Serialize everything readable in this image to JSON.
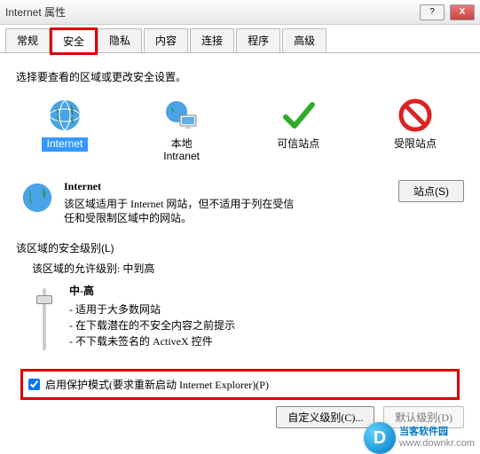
{
  "window": {
    "title": "Internet 属性",
    "help_symbol": "?",
    "close_symbol": "X"
  },
  "tabs": [
    {
      "label": "常规",
      "active": false
    },
    {
      "label": "安全",
      "active": true,
      "highlight": true
    },
    {
      "label": "隐私",
      "active": false
    },
    {
      "label": "内容",
      "active": false
    },
    {
      "label": "连接",
      "active": false
    },
    {
      "label": "程序",
      "active": false
    },
    {
      "label": "高级",
      "active": false
    }
  ],
  "zone_section_label": "选择要查看的区域或更改安全设置。",
  "zones": [
    {
      "icon": "globe",
      "label": "Internet",
      "selected": true
    },
    {
      "icon": "globe-monitor",
      "label": "本地\nIntranet",
      "selected": false
    },
    {
      "icon": "check",
      "label": "可信站点",
      "selected": false
    },
    {
      "icon": "forbidden",
      "label": "受限站点",
      "selected": false
    }
  ],
  "zone_detail": {
    "name": "Internet",
    "description": "该区域适用于 Internet 网站，但不适用于列在受信任和受限制区域中的网站。",
    "sites_button": "站点(S)"
  },
  "security_level": {
    "section_label": "该区域的安全级别(L)",
    "allowed_label": "该区域的允许级别: 中到高",
    "current_level": "中-高",
    "bullets": [
      "- 适用于大多数网站",
      "- 在下载潜在的不安全内容之前提示",
      "- 不下载未签名的 ActiveX 控件"
    ]
  },
  "protected_mode": {
    "checked": true,
    "label": "启用保护模式(要求重新启动 Internet Explorer)(P)"
  },
  "bottom_buttons": {
    "custom": "自定义级别(C)...",
    "default": "默认级别(D)"
  },
  "watermark": {
    "name": "当客软件园",
    "url": "www.downkr.com"
  }
}
